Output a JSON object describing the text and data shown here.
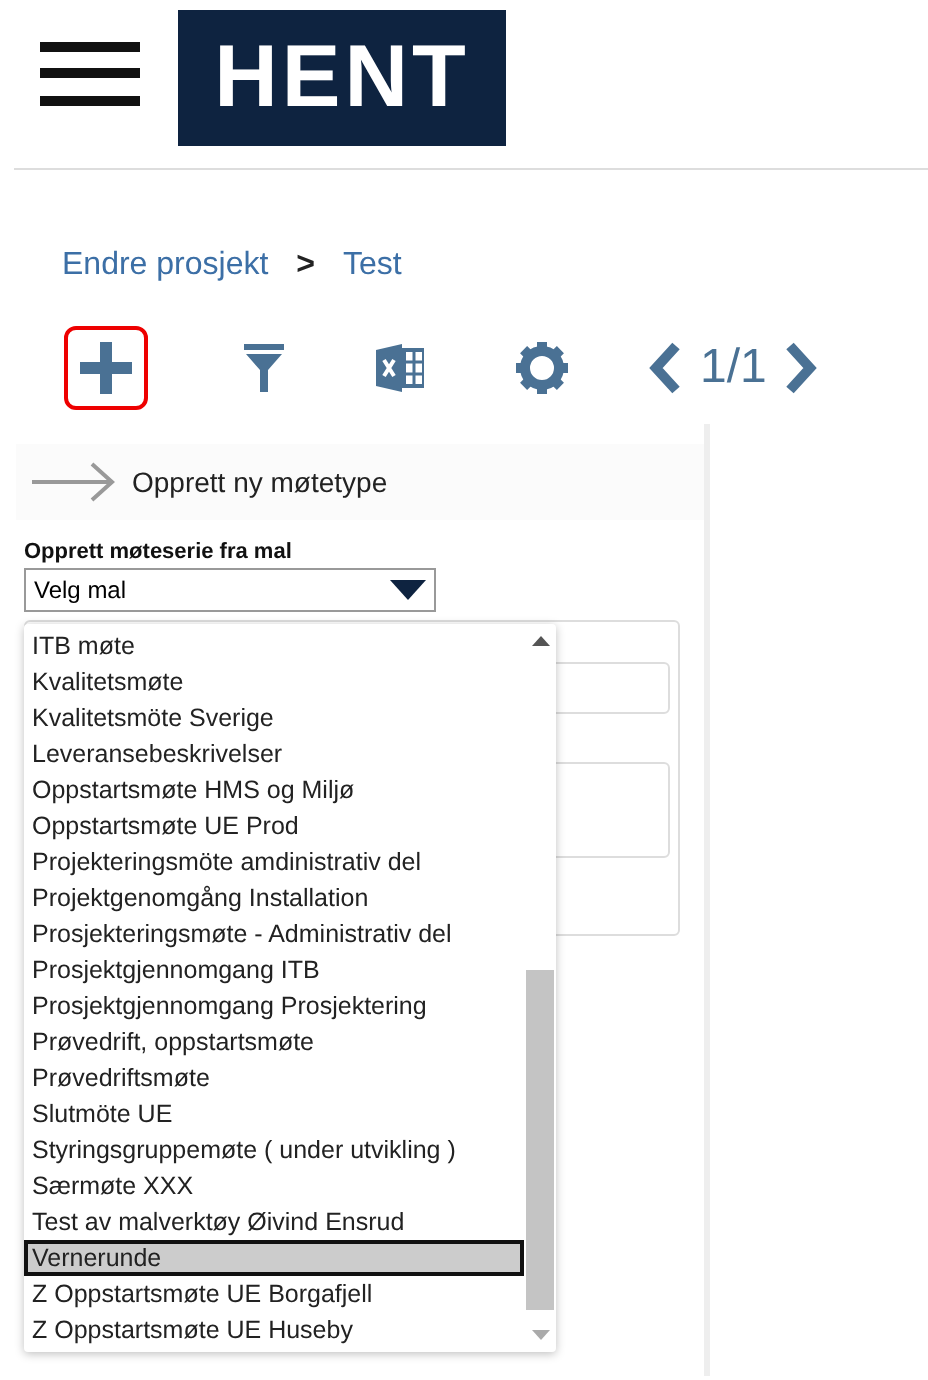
{
  "header": {
    "logo": "HENT"
  },
  "breadcrumb": [
    {
      "label": "Endre prosjekt"
    },
    {
      "label": ">"
    },
    {
      "label": "Test"
    }
  ],
  "toolbar": {
    "add_selected": true,
    "pager": "1/1"
  },
  "create_link": "Opprett ny møtetype",
  "template": {
    "label": "Opprett møteserie fra mal",
    "value": "Velg mal",
    "expanded": true,
    "options": [
      {
        "label": "ITB møte",
        "selected": false
      },
      {
        "label": "Kvalitetsmøte",
        "selected": false
      },
      {
        "label": "Kvalitetsmöte Sverige",
        "selected": false
      },
      {
        "label": "Leveransebeskrivelser",
        "selected": false
      },
      {
        "label": "Oppstartsmøte HMS og Miljø",
        "selected": false
      },
      {
        "label": "Oppstartsmøte UE Prod",
        "selected": false
      },
      {
        "label": "Projekteringsmöte amdinistrativ del",
        "selected": false
      },
      {
        "label": "Projektgenomgång Installation",
        "selected": false
      },
      {
        "label": "Prosjekteringsmøte - Administrativ del",
        "selected": false
      },
      {
        "label": "Prosjektgjennomgang ITB",
        "selected": false
      },
      {
        "label": "Prosjektgjennomgang Prosjektering",
        "selected": false
      },
      {
        "label": "Prøvedrift, oppstartsmøte",
        "selected": false
      },
      {
        "label": "Prøvedriftsmøte",
        "selected": false
      },
      {
        "label": "Slutmöte UE",
        "selected": false
      },
      {
        "label": "Styringsgruppemøte ( under utvikling )",
        "selected": false
      },
      {
        "label": "Særmøte XXX",
        "selected": false
      },
      {
        "label": "Test av malverktøy Øivind Ensrud",
        "selected": false
      },
      {
        "label": "Vernerunde",
        "selected": true
      },
      {
        "label": "Z Oppstartsmøte UE Borgafjell",
        "selected": false
      },
      {
        "label": "Z Oppstartsmøte UE Huseby",
        "selected": false
      }
    ]
  }
}
